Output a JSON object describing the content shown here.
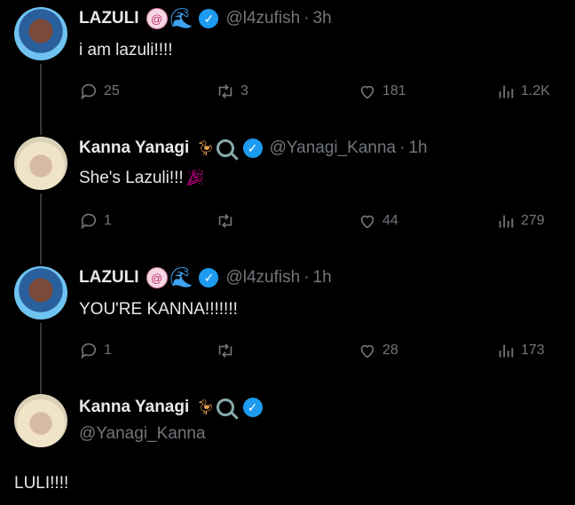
{
  "tweets": [
    {
      "name": "LAZULI",
      "handle": "@l4zufish",
      "time": "3h",
      "text": "i am lazuli!!!!",
      "stats": {
        "reply": "25",
        "retweet": "3",
        "like": "181",
        "views": "1.2K"
      },
      "emoji_icons": [
        "spiral-disc-icon",
        "wave-icon"
      ]
    },
    {
      "name": "Kanna Yanagi",
      "handle": "@Yanagi_Kanna",
      "time": "1h",
      "text": "She's Lazuli!!!",
      "stats": {
        "reply": "1",
        "retweet": "",
        "like": "44",
        "views": "279"
      },
      "emoji_icons": [
        "duck-icon",
        "magnifier-icon"
      ]
    },
    {
      "name": "LAZULI",
      "handle": "@l4zufish",
      "time": "1h",
      "text": "YOU'RE KANNA!!!!!!!",
      "stats": {
        "reply": "1",
        "retweet": "",
        "like": "28",
        "views": "173"
      },
      "emoji_icons": [
        "spiral-disc-icon",
        "wave-icon"
      ]
    }
  ],
  "focused": {
    "name": "Kanna Yanagi",
    "handle": "@Yanagi_Kanna",
    "text": "LULI!!!!",
    "emoji_icons": [
      "duck-icon",
      "magnifier-icon"
    ]
  },
  "separator": "·",
  "colors": {
    "background": "#000000",
    "text": "#e7e9ea",
    "muted": "#71767b",
    "verified": "#1d9bf0",
    "thread_line": "#333639"
  }
}
